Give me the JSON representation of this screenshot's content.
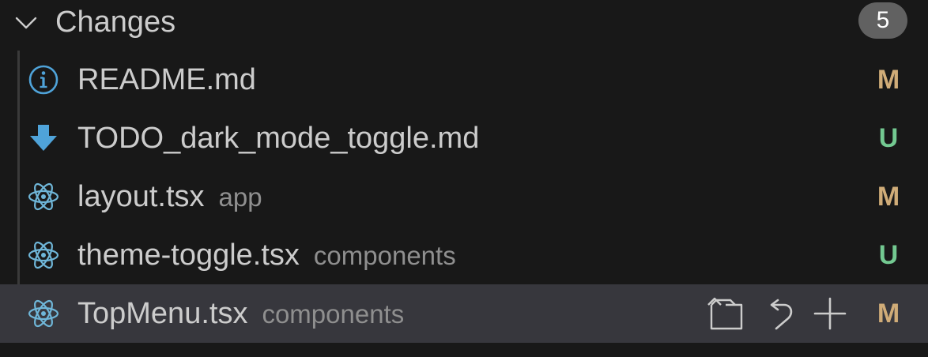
{
  "section": {
    "title": "Changes",
    "count": "5"
  },
  "colors": {
    "modified": "#d0ac78",
    "untracked": "#73c991",
    "info_icon": "#4fa3d9",
    "react_icon": "#6fb6d8",
    "download_icon": "#4fa3d9",
    "selected_row": "#37373d"
  },
  "files": [
    {
      "name": "README.md",
      "dir": "",
      "status": "M",
      "icon": "info-icon"
    },
    {
      "name": "TODO_dark_mode_toggle.md",
      "dir": "",
      "status": "U",
      "icon": "download-arrow-icon"
    },
    {
      "name": "layout.tsx",
      "dir": "app",
      "status": "M",
      "icon": "react-icon"
    },
    {
      "name": "theme-toggle.tsx",
      "dir": "components",
      "status": "U",
      "icon": "react-icon"
    },
    {
      "name": "TopMenu.tsx",
      "dir": "components",
      "status": "M",
      "icon": "react-icon"
    }
  ],
  "row_actions": [
    "open-file-icon",
    "discard-changes-icon",
    "stage-changes-icon"
  ]
}
